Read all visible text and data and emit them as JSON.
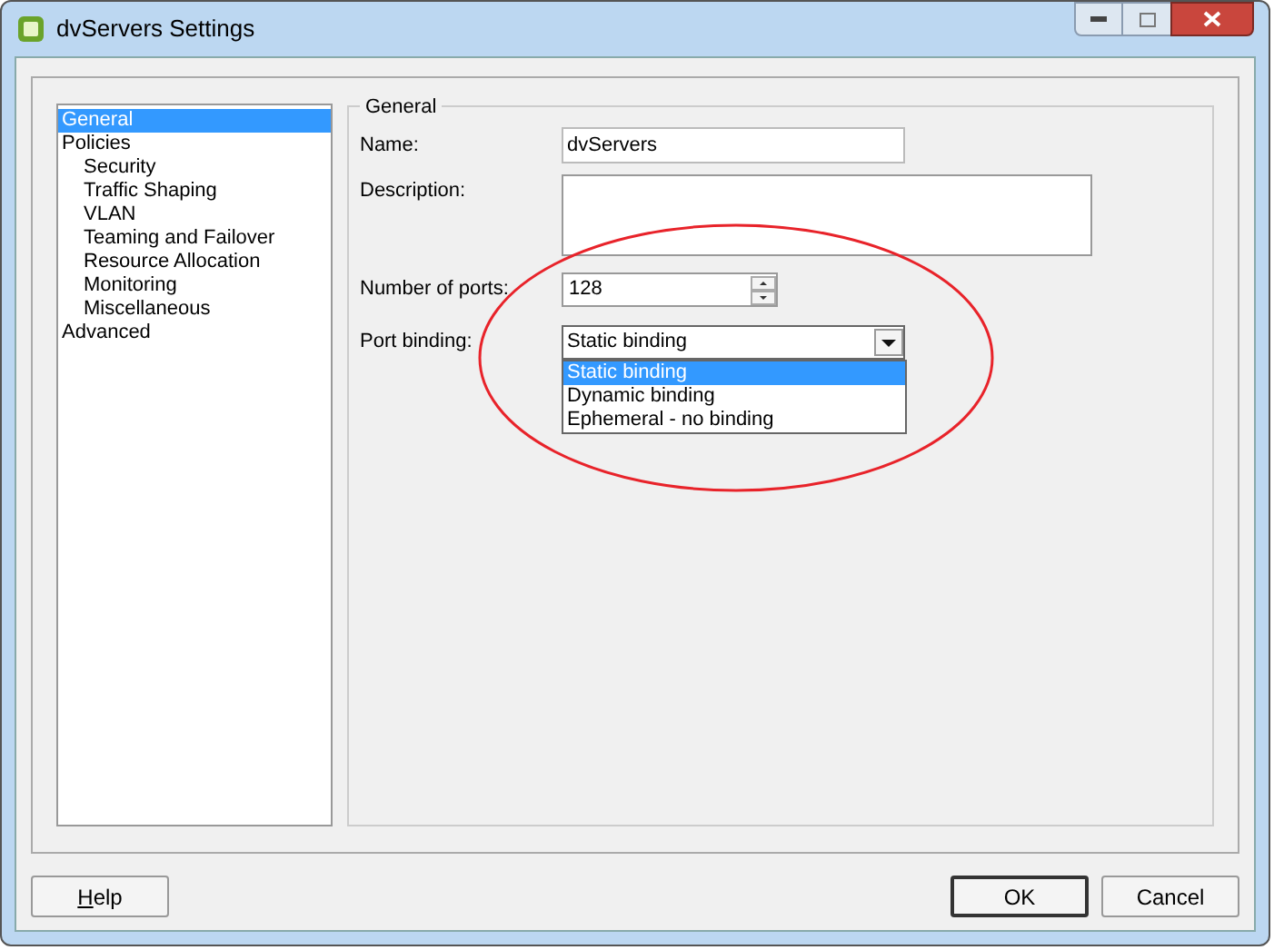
{
  "window": {
    "title": "dvServers Settings"
  },
  "tree": [
    {
      "label": "General",
      "selected": true
    },
    {
      "label": "Policies",
      "selected": false,
      "children": [
        {
          "label": "Security",
          "selected": false
        },
        {
          "label": "Traffic Shaping",
          "selected": false
        },
        {
          "label": "VLAN",
          "selected": false
        },
        {
          "label": "Teaming and Failover",
          "selected": false
        },
        {
          "label": "Resource Allocation",
          "selected": false
        },
        {
          "label": "Monitoring",
          "selected": false
        },
        {
          "label": "Miscellaneous",
          "selected": false
        }
      ]
    },
    {
      "label": "Advanced",
      "selected": false
    }
  ],
  "group": {
    "title": "General",
    "name": {
      "label": "Name:",
      "value": "dvServers"
    },
    "description": {
      "label": "Description:"
    },
    "ports": {
      "label": "Number of ports:",
      "value": "128"
    },
    "binding": {
      "label": "Port binding:",
      "value": "Static binding",
      "expanded": true,
      "options": [
        {
          "label": "Static binding",
          "selected": true
        },
        {
          "label": "Dynamic binding",
          "selected": false
        },
        {
          "label": "Ephemeral - no binding",
          "selected": false
        }
      ]
    }
  },
  "buttons": [
    {
      "label": "Help",
      "kind": "help"
    },
    {
      "label": "OK",
      "kind": "default"
    },
    {
      "label": "Cancel",
      "kind": "normal"
    }
  ],
  "annotation": {
    "kind": "ellipse"
  }
}
